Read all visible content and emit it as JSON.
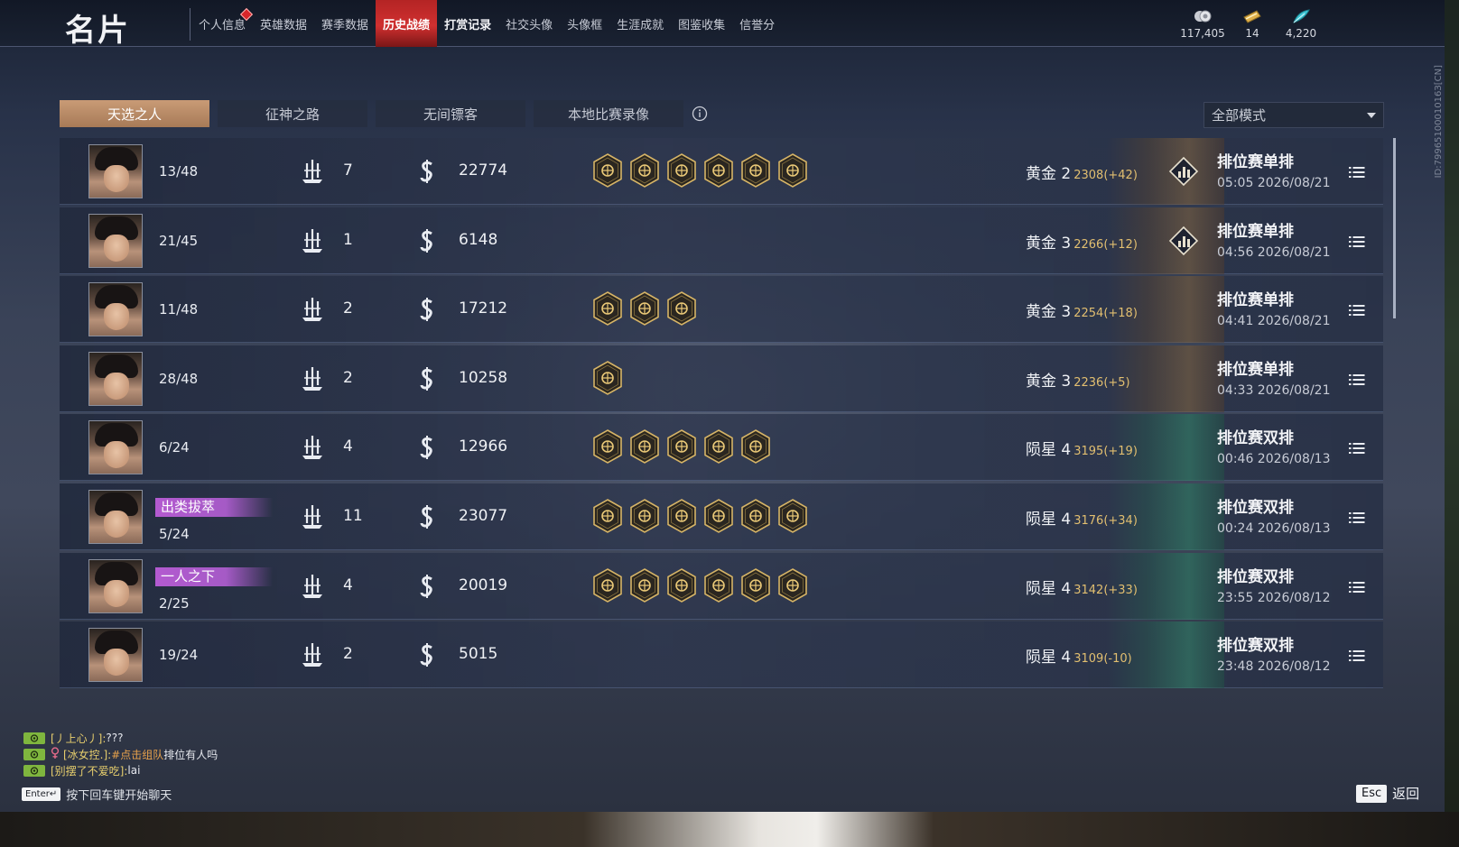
{
  "header": {
    "title": "名片",
    "nav": [
      {
        "label": "个人信息"
      },
      {
        "label": "英雄数据"
      },
      {
        "label": "赛季数据"
      },
      {
        "label": "历史战绩"
      },
      {
        "label": "打赏记录"
      },
      {
        "label": "社交头像"
      },
      {
        "label": "头像框"
      },
      {
        "label": "生涯成就"
      },
      {
        "label": "图鉴收集"
      },
      {
        "label": "信誉分"
      }
    ],
    "currencies": [
      {
        "icon": "coin-stack-icon",
        "value": "117,405"
      },
      {
        "icon": "ticket-icon",
        "value": "14"
      },
      {
        "icon": "feather-icon",
        "value": "4,220"
      }
    ]
  },
  "side_id": "ID:7996510001016З[CN]",
  "tabs": [
    {
      "label": "天选之人"
    },
    {
      "label": "征神之路"
    },
    {
      "label": "无间镖客"
    },
    {
      "label": "本地比赛录像"
    }
  ],
  "mode_filter": {
    "selected": "全部模式"
  },
  "matches": [
    {
      "title": "",
      "placement": "13/48",
      "kills": "7",
      "money": "22774",
      "badges": 6,
      "tier": "黄金 2",
      "score": "2308(+42)",
      "emblem": true,
      "art": "gold",
      "mode": "排位赛单排",
      "time": "05:05 2026/08/21"
    },
    {
      "title": "",
      "placement": "21/45",
      "kills": "1",
      "money": "6148",
      "badges": 0,
      "tier": "黄金 3",
      "score": "2266(+12)",
      "emblem": true,
      "art": "gold",
      "mode": "排位赛单排",
      "time": "04:56 2026/08/21"
    },
    {
      "title": "",
      "placement": "11/48",
      "kills": "2",
      "money": "17212",
      "badges": 3,
      "tier": "黄金 3",
      "score": "2254(+18)",
      "emblem": false,
      "art": "gold",
      "mode": "排位赛单排",
      "time": "04:41 2026/08/21"
    },
    {
      "title": "",
      "placement": "28/48",
      "kills": "2",
      "money": "10258",
      "badges": 1,
      "tier": "黄金 3",
      "score": "2236(+5)",
      "emblem": false,
      "art": "gold",
      "mode": "排位赛单排",
      "time": "04:33 2026/08/21"
    },
    {
      "title": "",
      "placement": "6/24",
      "kills": "4",
      "money": "12966",
      "badges": 5,
      "tier": "陨星 4",
      "score": "3195(+19)",
      "emblem": false,
      "art": "green",
      "mode": "排位赛双排",
      "time": "00:46 2026/08/13"
    },
    {
      "title": "出类拔萃",
      "placement": "5/24",
      "kills": "11",
      "money": "23077",
      "badges": 6,
      "tier": "陨星 4",
      "score": "3176(+34)",
      "emblem": false,
      "art": "green",
      "mode": "排位赛双排",
      "time": "00:24 2026/08/13"
    },
    {
      "title": "一人之下",
      "placement": "2/25",
      "kills": "4",
      "money": "20019",
      "badges": 6,
      "tier": "陨星 4",
      "score": "3142(+33)",
      "emblem": false,
      "art": "green",
      "mode": "排位赛双排",
      "time": "23:55 2026/08/12"
    },
    {
      "title": "",
      "placement": "19/24",
      "kills": "2",
      "money": "5015",
      "badges": 0,
      "tier": "陨星 4",
      "score": "3109(-10)",
      "emblem": false,
      "art": "green",
      "mode": "排位赛双排",
      "time": "23:48 2026/08/12"
    }
  ],
  "chat": {
    "messages": [
      {
        "name": "[丿上心丿]:",
        "link": "",
        "text": "???"
      },
      {
        "name": "[冰女控.]:",
        "link": "#点击组队",
        "text": " 排位有人吗"
      },
      {
        "name": "[别摆了不爱吃]:",
        "link": "",
        "text": "lai"
      }
    ],
    "enter_key": "Enter↵",
    "hint": "按下回车键开始聊天"
  },
  "footer": {
    "esc_key": "Esc",
    "back_label": "返回"
  },
  "colors": {
    "accent_red": "#d03030",
    "tab_active": "#b88865",
    "score_gold": "#e2bf70",
    "title_purple": "#b35ad0",
    "chat_tag_green": "#7fb63e"
  }
}
